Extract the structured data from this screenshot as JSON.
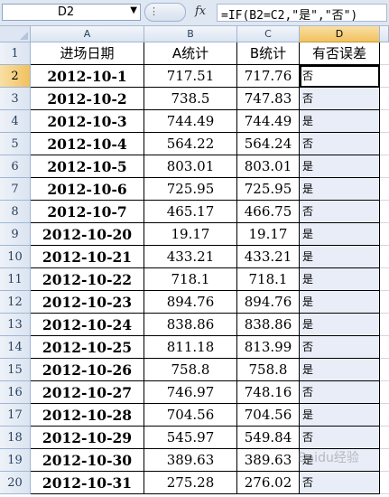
{
  "formula_bar": {
    "name_box": "D2",
    "fx_label": "fx",
    "formula": "=IF(B2=C2,\"是\",\"否\")"
  },
  "columns": [
    "A",
    "B",
    "C",
    "D"
  ],
  "header_row": {
    "row_number": "1",
    "a": "进场日期",
    "b": "A统计",
    "c": "B统计",
    "d": "有否误差"
  },
  "rows": [
    {
      "n": "2",
      "a": "2012-10-1",
      "b": "717.51",
      "c": "717.76",
      "d": "否"
    },
    {
      "n": "3",
      "a": "2012-10-2",
      "b": "738.5",
      "c": "747.83",
      "d": "否"
    },
    {
      "n": "4",
      "a": "2012-10-3",
      "b": "744.49",
      "c": "744.49",
      "d": "是"
    },
    {
      "n": "5",
      "a": "2012-10-4",
      "b": "564.22",
      "c": "564.24",
      "d": "否"
    },
    {
      "n": "6",
      "a": "2012-10-5",
      "b": "803.01",
      "c": "803.01",
      "d": "是"
    },
    {
      "n": "7",
      "a": "2012-10-6",
      "b": "725.95",
      "c": "725.95",
      "d": "是"
    },
    {
      "n": "8",
      "a": "2012-10-7",
      "b": "465.17",
      "c": "466.75",
      "d": "否"
    },
    {
      "n": "9",
      "a": "2012-10-20",
      "b": "19.17",
      "c": "19.17",
      "d": "是"
    },
    {
      "n": "10",
      "a": "2012-10-21",
      "b": "433.21",
      "c": "433.21",
      "d": "是"
    },
    {
      "n": "11",
      "a": "2012-10-22",
      "b": "718.1",
      "c": "718.1",
      "d": "是"
    },
    {
      "n": "12",
      "a": "2012-10-23",
      "b": "894.76",
      "c": "894.76",
      "d": "是"
    },
    {
      "n": "13",
      "a": "2012-10-24",
      "b": "838.86",
      "c": "838.86",
      "d": "是"
    },
    {
      "n": "14",
      "a": "2012-10-25",
      "b": "811.18",
      "c": "813.99",
      "d": "否"
    },
    {
      "n": "15",
      "a": "2012-10-26",
      "b": "758.8",
      "c": "758.8",
      "d": "是"
    },
    {
      "n": "16",
      "a": "2012-10-27",
      "b": "746.97",
      "c": "748.16",
      "d": "否"
    },
    {
      "n": "17",
      "a": "2012-10-28",
      "b": "704.56",
      "c": "704.56",
      "d": "是"
    },
    {
      "n": "18",
      "a": "2012-10-29",
      "b": "545.97",
      "c": "549.84",
      "d": "否"
    },
    {
      "n": "19",
      "a": "2012-10-30",
      "b": "389.63",
      "c": "389.63",
      "d": "是"
    },
    {
      "n": "20",
      "a": "2012-10-31",
      "b": "275.28",
      "c": "276.02",
      "d": "否"
    }
  ],
  "watermark": "Baidu经验"
}
